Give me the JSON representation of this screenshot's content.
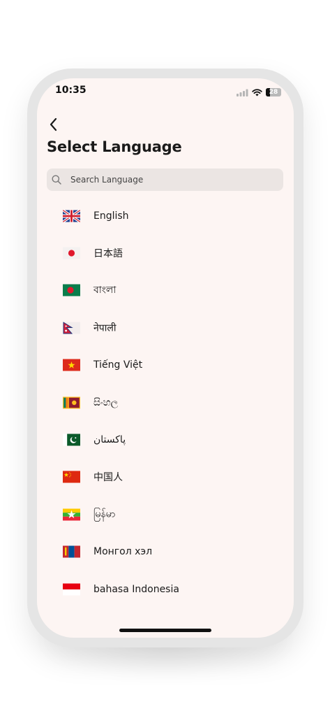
{
  "status": {
    "time": "10:35",
    "battery": "28"
  },
  "header": {
    "title": "Select Language"
  },
  "search": {
    "placeholder": "Search Language",
    "value": ""
  },
  "languages": [
    {
      "label": "English",
      "flag": "uk-flag-icon"
    },
    {
      "label": "日本語",
      "flag": "japan-flag-icon"
    },
    {
      "label": "বাংলা",
      "flag": "bangladesh-flag-icon"
    },
    {
      "label": "नेपाली",
      "flag": "nepal-flag-icon"
    },
    {
      "label": "Tiếng Việt",
      "flag": "vietnam-flag-icon"
    },
    {
      "label": "සිංහල",
      "flag": "sri-lanka-flag-icon"
    },
    {
      "label": "پاکستان",
      "flag": "pakistan-flag-icon"
    },
    {
      "label": "中国人",
      "flag": "china-flag-icon"
    },
    {
      "label": "မြန်မာ",
      "flag": "myanmar-flag-icon"
    },
    {
      "label": "Монгол хэл",
      "flag": "mongolia-flag-icon"
    },
    {
      "label": "bahasa Indonesia",
      "flag": "indonesia-flag-icon"
    }
  ],
  "colors": {
    "screen_background": "#fdf5f3",
    "search_background": "#ebe5e3",
    "frame": "#e5e5e5",
    "text": "#1a1a1a"
  }
}
